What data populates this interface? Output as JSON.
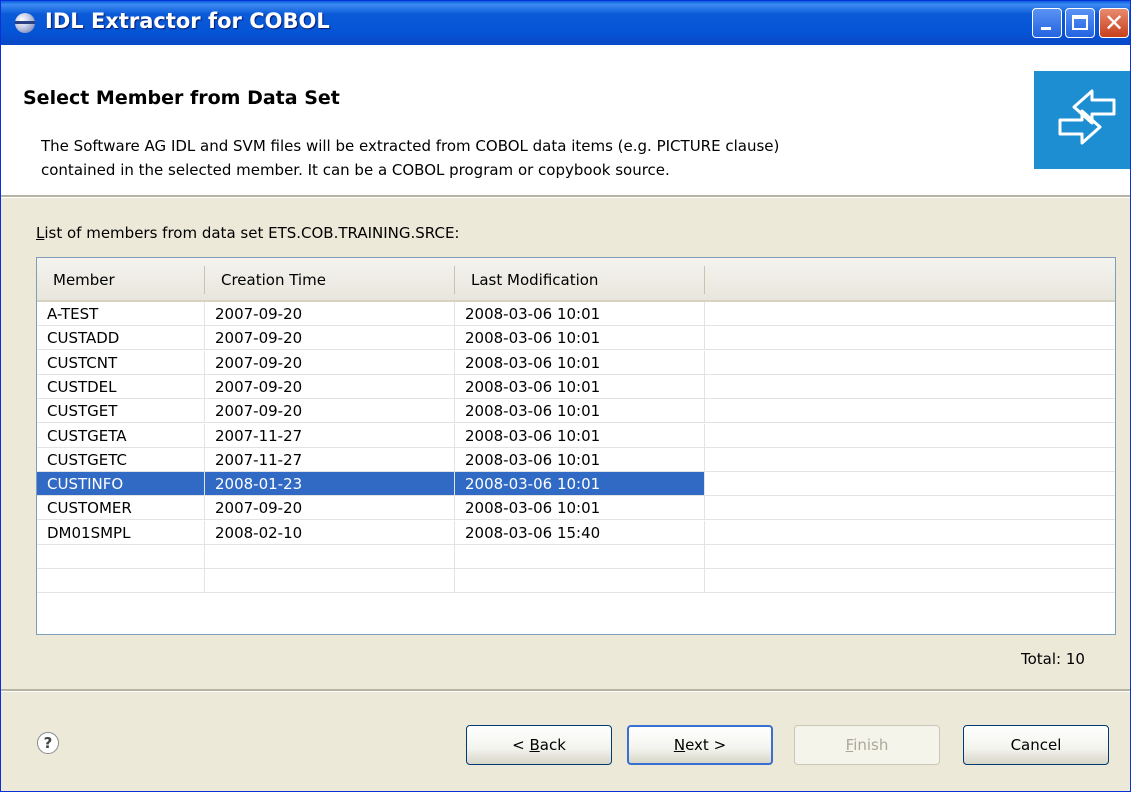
{
  "window": {
    "title": "IDL Extractor for COBOL"
  },
  "header": {
    "title": "Select Member from Data Set",
    "description_line1": "The Software AG IDL and SVM files will be extracted from COBOL data items (e.g. PICTURE clause)",
    "description_line2": "contained in the selected member. It can be a COBOL program or copybook source."
  },
  "list": {
    "label_mnemonic": "L",
    "label_rest": "ist of members from data set ETS.COB.TRAINING.SRCE:",
    "columns": [
      "Member",
      "Creation Time",
      "Last Modification"
    ],
    "rows": [
      [
        "A-TEST",
        "2007-09-20",
        "2008-03-06 10:01"
      ],
      [
        "CUSTADD",
        "2007-09-20",
        "2008-03-06 10:01"
      ],
      [
        "CUSTCNT",
        "2007-09-20",
        "2008-03-06 10:01"
      ],
      [
        "CUSTDEL",
        "2007-09-20",
        "2008-03-06 10:01"
      ],
      [
        "CUSTGET",
        "2007-09-20",
        "2008-03-06 10:01"
      ],
      [
        "CUSTGETA",
        "2007-11-27",
        "2008-03-06 10:01"
      ],
      [
        "CUSTGETC",
        "2007-11-27",
        "2008-03-06 10:01"
      ],
      [
        "CUSTINFO",
        "2008-01-23",
        "2008-03-06 10:01"
      ],
      [
        "CUSTOMER",
        "2007-09-20",
        "2008-03-06 10:01"
      ],
      [
        "DM01SMPL",
        "2008-02-10",
        "2008-03-06 15:40"
      ]
    ],
    "selected_member": "CUSTINFO",
    "total": "Total: 10"
  },
  "buttons": {
    "back_prefix": "< ",
    "back_mnemonic": "B",
    "back_rest": "ack",
    "next_mnemonic": "N",
    "next_rest": "ext >",
    "finish_mnemonic": "F",
    "finish_rest": "inish",
    "cancel": "Cancel"
  },
  "help_icon_glyph": "?",
  "colors": {
    "selection": "#316ac5",
    "titlebar": "#0454d6",
    "banner": "#1d8ed1"
  }
}
